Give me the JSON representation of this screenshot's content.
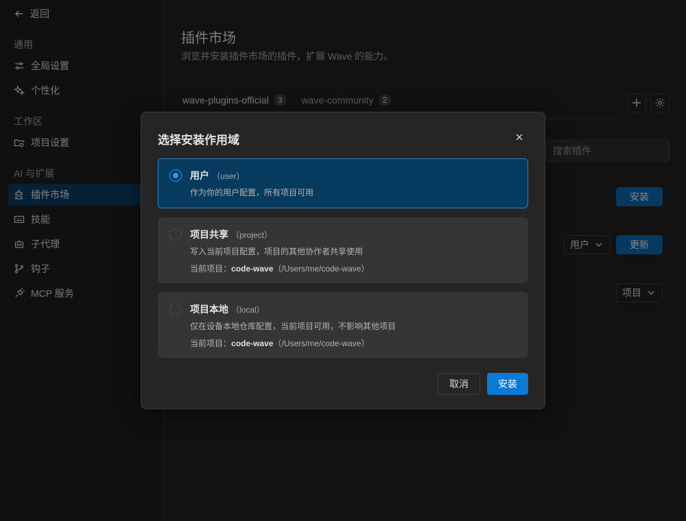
{
  "sidebar": {
    "back_label": "返回",
    "sections": {
      "general": "通用",
      "workspace": "工作区",
      "ai": "AI 与扩展"
    },
    "items": [
      {
        "label": "全局设置",
        "icon": "sliders-icon"
      },
      {
        "label": "个性化",
        "icon": "sparkle-icon"
      },
      {
        "label": "项目设置",
        "icon": "folder-gear-icon"
      },
      {
        "label": "插件市场",
        "icon": "puzzle-icon",
        "active": true
      },
      {
        "label": "技能",
        "icon": "keyboard-icon"
      },
      {
        "label": "子代理",
        "icon": "robot-icon"
      },
      {
        "label": "钩子",
        "icon": "git-branch-icon"
      },
      {
        "label": "MCP 服务",
        "icon": "plug-icon"
      }
    ]
  },
  "main": {
    "title": "插件市场",
    "subtitle": "浏览并安装插件市场的插件，扩展 Wave 的能力。",
    "tabs": [
      {
        "label": "wave-plugins-official",
        "count": "3"
      },
      {
        "label": "wave-community",
        "count": "2"
      }
    ],
    "search_placeholder": "搜索插件",
    "row_buttons": {
      "install": "安装",
      "scope_user": "用户",
      "update": "更新",
      "scope_project": "项目"
    }
  },
  "modal": {
    "title": "选择安装作用域",
    "options": [
      {
        "title": "用户",
        "tag": "（user）",
        "desc": "作为你的用户配置，所有项目可用",
        "selected": true
      },
      {
        "title": "项目共享",
        "tag": "（project）",
        "desc": "写入当前项目配置，项目的其他协作者共享使用",
        "project_prefix": "当前项目：",
        "project_name": "code-wave",
        "project_path": "（/Users/me/code-wave）"
      },
      {
        "title": "项目本地",
        "tag": "（local）",
        "desc": "仅在设备本地仓库配置，当前项目可用，不影响其他项目",
        "project_prefix": "当前项目：",
        "project_name": "code-wave",
        "project_path": "（/Users/me/code-wave）"
      }
    ],
    "cancel_label": "取消",
    "install_label": "安装"
  },
  "colors": {
    "accent": "#0a7ad6",
    "selected_bg": "#063a5f",
    "background": "#1f1f1f"
  }
}
